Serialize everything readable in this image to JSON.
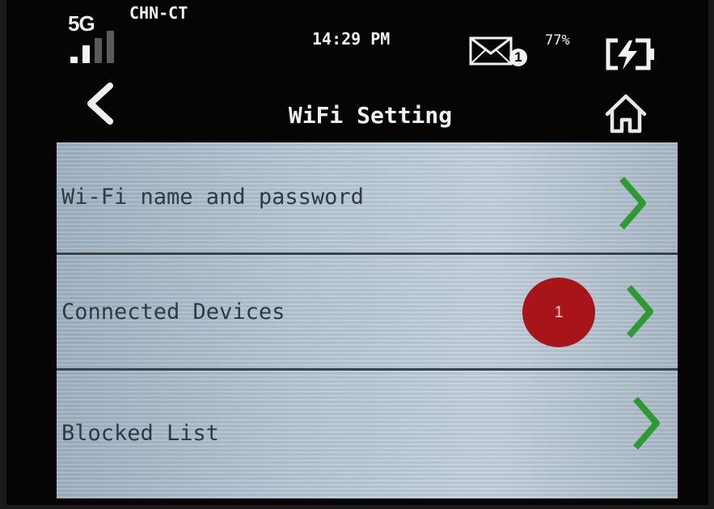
{
  "statusbar": {
    "network_type": "5G",
    "carrier": "CHN-CT",
    "time": "14:29 PM",
    "message_count": "1",
    "battery_percent": "77%",
    "signal_bars_active": 2,
    "signal_bars_total": 4,
    "charging": true
  },
  "header": {
    "title": "WiFi Setting",
    "back_icon": "chevron-left-icon",
    "home_icon": "home-icon"
  },
  "menu": {
    "items": [
      {
        "label": "Wi-Fi name and password",
        "badge": null
      },
      {
        "label": "Connected Devices",
        "badge": "1"
      },
      {
        "label": "Blocked List",
        "badge": null
      }
    ]
  },
  "colors": {
    "chevron": "#2e9a35",
    "badge": "#a7151b",
    "row_text": "#2f3a44",
    "background": "#050505"
  }
}
